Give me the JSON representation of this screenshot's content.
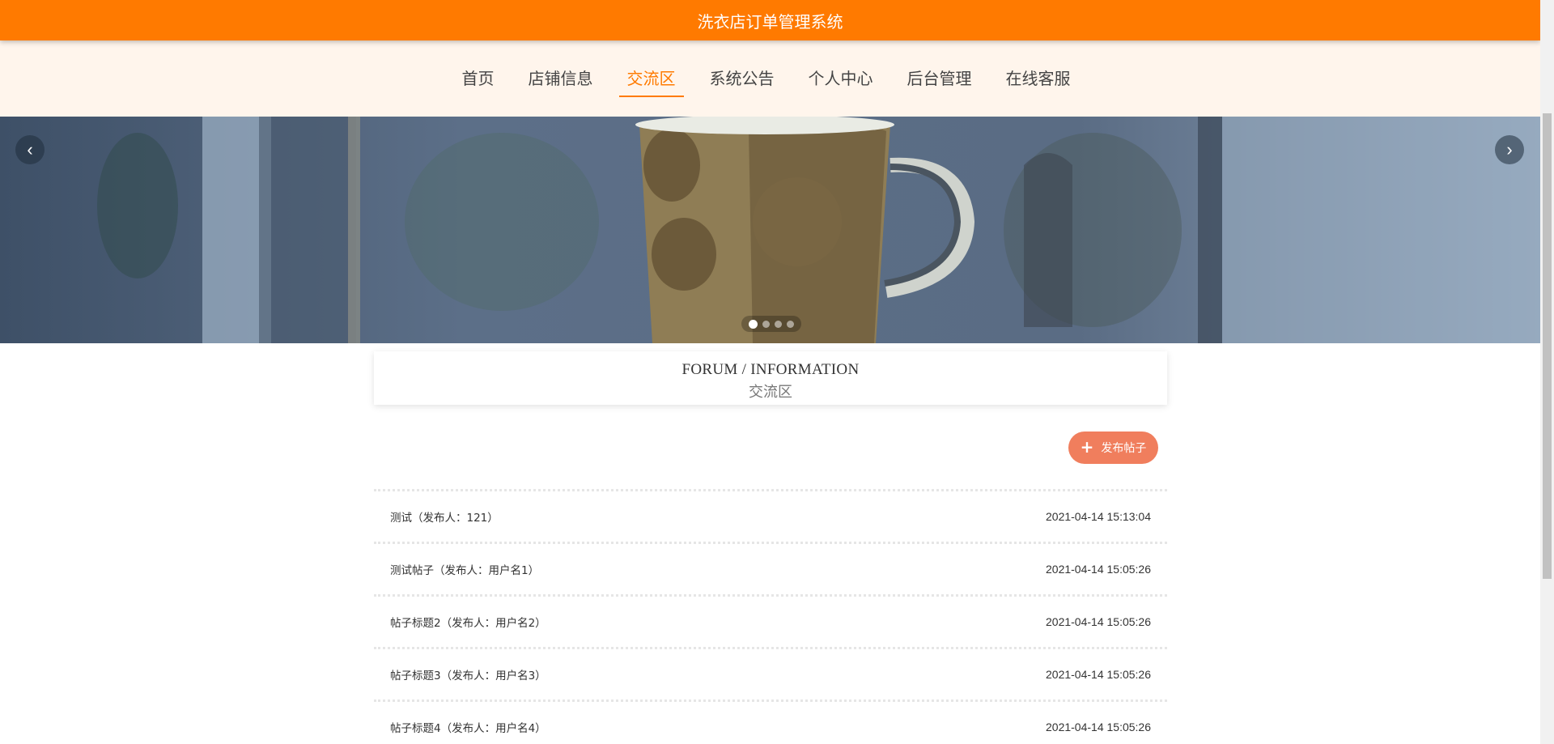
{
  "header": {
    "title": "洗衣店订单管理系统"
  },
  "nav": {
    "items": [
      {
        "label": "首页"
      },
      {
        "label": "店铺信息"
      },
      {
        "label": "交流区"
      },
      {
        "label": "系统公告"
      },
      {
        "label": "个人中心"
      },
      {
        "label": "后台管理"
      },
      {
        "label": "在线客服"
      }
    ],
    "active_index": 2
  },
  "banner": {
    "prev_icon": "‹",
    "next_icon": "›",
    "slide_count": 4,
    "active_slide": 0
  },
  "section": {
    "title_en": "FORUM / INFORMATION",
    "title_cn": "交流区"
  },
  "actions": {
    "publish_label": "发布帖子",
    "publish_icon": "+"
  },
  "posts": [
    {
      "title": "测试（发布人：121）",
      "time": "2021-04-14 15:13:04"
    },
    {
      "title": "测试帖子（发布人：用户名1）",
      "time": "2021-04-14 15:05:26"
    },
    {
      "title": "帖子标题2（发布人：用户名2）",
      "time": "2021-04-14 15:05:26"
    },
    {
      "title": "帖子标题3（发布人：用户名3）",
      "time": "2021-04-14 15:05:26"
    },
    {
      "title": "帖子标题4（发布人：用户名4）",
      "time": "2021-04-14 15:05:26"
    }
  ],
  "colors": {
    "brand": "#ff7a00",
    "nav_bg": "#fff5ec",
    "publish_button": "#f07e5d"
  }
}
